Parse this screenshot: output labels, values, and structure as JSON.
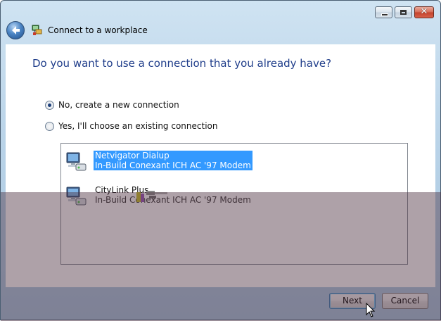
{
  "window": {
    "title": "Connect to a workplace",
    "controls": {
      "minimize": "minimize",
      "maximize": "maximize",
      "close": "close"
    }
  },
  "heading": "Do you want to use a connection that you already have?",
  "options": [
    {
      "label": "No, create a new connection",
      "checked": true
    },
    {
      "label": "Yes, I'll choose an existing connection",
      "checked": false
    }
  ],
  "connections": [
    {
      "name": "Netvigator Dialup",
      "device": "In-Build Conexant ICH AC '97 Modem",
      "selected": true
    },
    {
      "name": "CityLink Plus",
      "device": "In-Build Conexant ICH AC '97 Modem",
      "selected": false
    }
  ],
  "buttons": {
    "next": "Next",
    "cancel": "Cancel"
  },
  "icons": {
    "back": "back-arrow-icon",
    "title": "network-workplace-icon",
    "connection": "dialup-modem-icon"
  },
  "colors": {
    "heading": "#1f3d8a",
    "selection": "#3399ff",
    "overlay": "#4c2e3e"
  }
}
